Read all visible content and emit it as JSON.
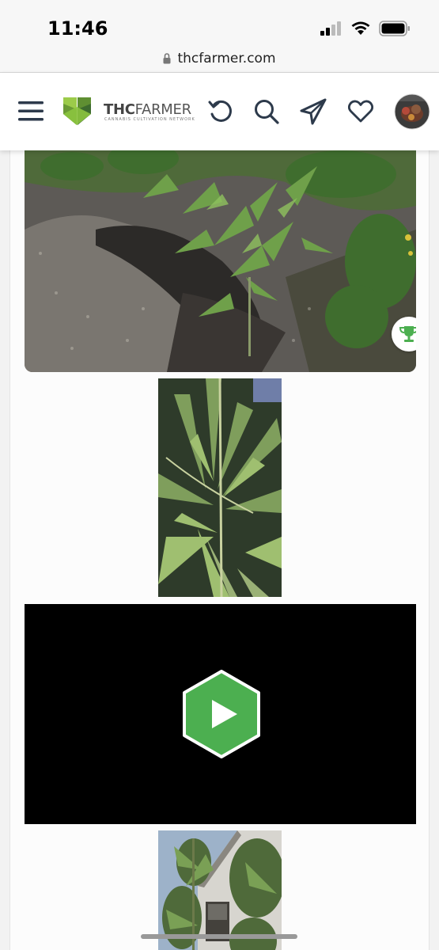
{
  "status_bar": {
    "time": "11:46",
    "icons": [
      "signal-icon",
      "wifi-icon",
      "battery-icon"
    ]
  },
  "browser": {
    "url": "thcfarmer.com",
    "lock_icon": "lock-icon"
  },
  "header": {
    "menu_icon": "hamburger-menu-icon",
    "logo_text_bold": "THC",
    "logo_text_light": "FARMER",
    "logo_subtitle": "CANNABIS CULTIVATION NETWORK",
    "actions": [
      "refresh-icon",
      "search-icon",
      "send-icon",
      "heart-icon"
    ],
    "avatar": "user-avatar"
  },
  "colors": {
    "brand_green": "#4caf50",
    "logo_green_dark": "#3d6b2e",
    "logo_green_light": "#8cc43f",
    "nav_icon": "#2d3a4b"
  },
  "media": [
    {
      "type": "photo",
      "subject": "cannabis plants in garden bed"
    },
    {
      "type": "photo",
      "subject": "cannabis leaves close-up"
    },
    {
      "type": "video"
    },
    {
      "type": "photo",
      "subject": "cannabis plant beside house"
    }
  ]
}
